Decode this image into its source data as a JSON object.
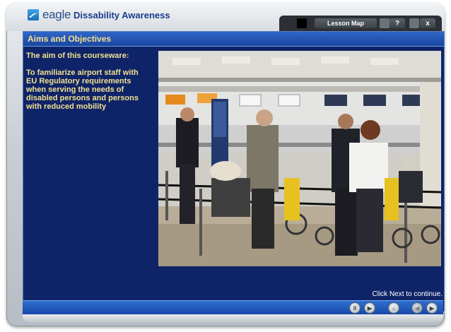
{
  "app": {
    "logo_word": "eagle",
    "title": "Dissability Awareness"
  },
  "toolbar": {
    "lesson_map_label": "Lesson Map",
    "help_label": "?",
    "close_label": "x"
  },
  "section": {
    "header": "Aims and Objectives",
    "intro": "The aim of this courseware:",
    "body": "To familiarize airport staff with EU Regulatory requirements when serving the needs of disabled persons and persons with reduced mobility"
  },
  "footer": {
    "continue_text": "Click Next to continue."
  },
  "nav": {
    "pause_label": "II",
    "play_label": "▶",
    "home_label": "⌂",
    "prev_label": "◀",
    "next_label": "▶"
  },
  "colors": {
    "content_bg": "#0f2468",
    "header_bar": "#2f66c8",
    "text_yellow": "#f2e08f"
  }
}
